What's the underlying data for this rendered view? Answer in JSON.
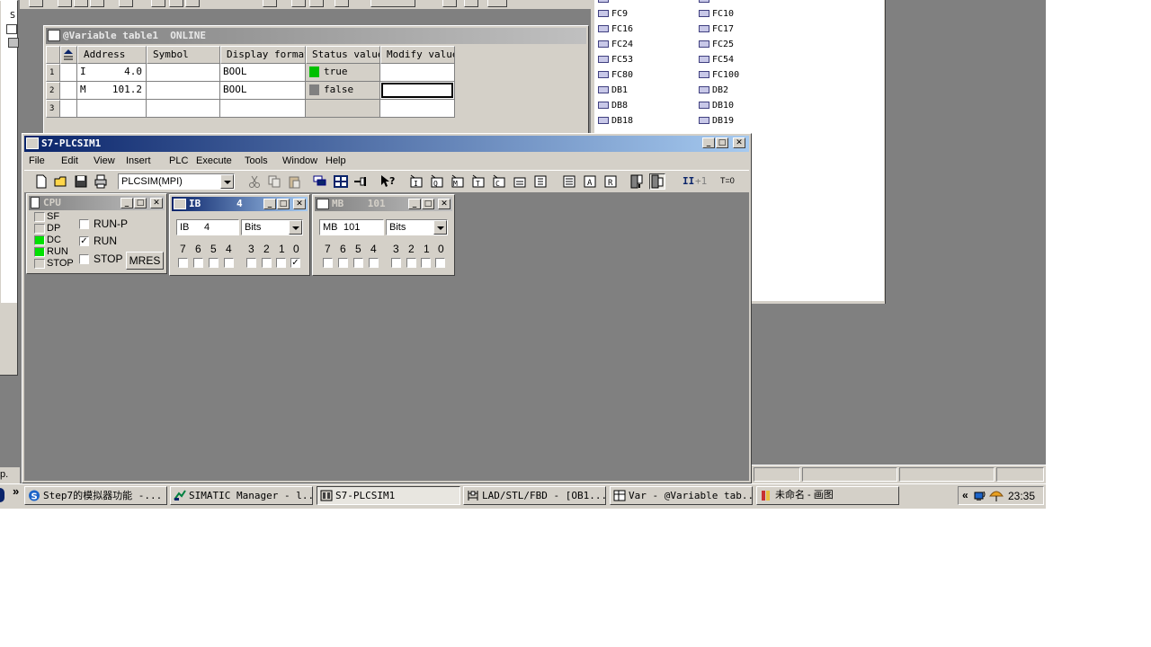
{
  "variable_table": {
    "title": "@Variable table1  ONLINE",
    "columns": [
      "Address",
      "Symbol",
      "Display format",
      "Status value",
      "Modify value"
    ],
    "rows": [
      {
        "num": "1",
        "address_area": "I",
        "address_val": "4.0",
        "symbol": "",
        "format": "BOOL",
        "status": "true",
        "status_color": "#00c000",
        "modify": ""
      },
      {
        "num": "2",
        "address_area": "M",
        "address_val": "101.2",
        "symbol": "",
        "format": "BOOL",
        "status": "false",
        "status_color": "#808080",
        "modify": ""
      },
      {
        "num": "3",
        "address_area": "",
        "address_val": "",
        "symbol": "",
        "format": "",
        "status": "",
        "status_color": "",
        "modify": ""
      }
    ]
  },
  "blocks": {
    "left": [
      "FC9",
      "FC16",
      "FC24",
      "FC53",
      "FC80",
      "DB1",
      "DB8",
      "DB18"
    ],
    "right": [
      "FC10",
      "FC17",
      "FC25",
      "FC54",
      "FC100",
      "DB2",
      "DB10",
      "DB19"
    ]
  },
  "plcsim": {
    "title": "S7-PLCSIM1",
    "menu": [
      "File",
      "Edit",
      "View",
      "Insert",
      "PLC",
      "Execute",
      "Tools",
      "Window",
      "Help"
    ],
    "interface_select": "PLCSIM(MPI)",
    "tb_pause": "II",
    "tb_step": "+1",
    "tb_reset": "T=0",
    "cpu": {
      "title": "CPU",
      "leds": [
        {
          "label": "SF",
          "color": "#d4d0c8"
        },
        {
          "label": "DP",
          "color": "#d4d0c8"
        },
        {
          "label": "DC",
          "color": "#00e000"
        },
        {
          "label": "RUN",
          "color": "#00e000"
        },
        {
          "label": "STOP",
          "color": "#d4d0c8"
        }
      ],
      "modes": [
        {
          "label": "RUN-P",
          "checked": ""
        },
        {
          "label": "RUN",
          "checked": "✓"
        },
        {
          "label": "STOP",
          "checked": ""
        }
      ],
      "mres_label": "MRES"
    },
    "ib": {
      "title": "IB      4",
      "area": "IB",
      "addr": "4",
      "format": "Bits",
      "bit_labels": [
        "7",
        "6",
        "5",
        "4",
        "3",
        "2",
        "1",
        "0"
      ],
      "bits": [
        "",
        "",
        "",
        "",
        "",
        "",
        "",
        "✓"
      ]
    },
    "mb": {
      "title": "MB    101",
      "area": "MB",
      "addr": "101",
      "format": "Bits",
      "bit_labels": [
        "7",
        "6",
        "5",
        "4",
        "3",
        "2",
        "1",
        "0"
      ],
      "bits": [
        "",
        "",
        "",
        "",
        "",
        "",
        "",
        ""
      ]
    }
  },
  "left_fragment": {
    "s_label": "S",
    "status_p": "p."
  },
  "taskbar": {
    "items": [
      {
        "label": "Step7的模拟器功能 -...",
        "icon": "browser-icon",
        "active": false
      },
      {
        "label": "SIMATIC Manager - l...",
        "icon": "simatic-icon",
        "active": false
      },
      {
        "label": "S7-PLCSIM1",
        "icon": "plcsim-icon",
        "active": true
      },
      {
        "label": "LAD/STL/FBD  - [OB1...",
        "icon": "ladder-icon",
        "active": false
      },
      {
        "label": "Var - @Variable tab...",
        "icon": "variable-table-icon",
        "active": false
      },
      {
        "label": "未命名 - 画图",
        "icon": "paint-icon",
        "active": false
      }
    ],
    "chevron": "»",
    "tray_chevron": "«",
    "clock": "23:35"
  }
}
